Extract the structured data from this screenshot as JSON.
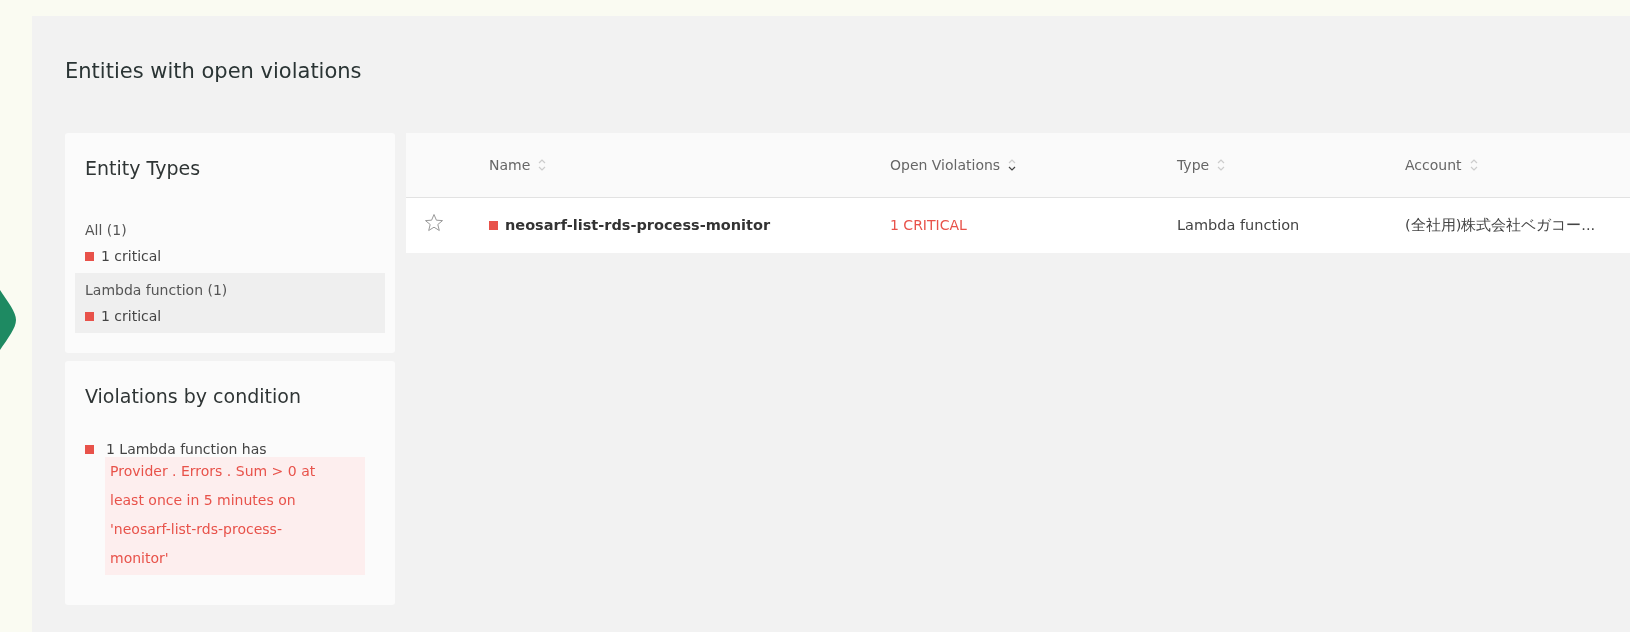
{
  "title": "Entities with open violations",
  "entity_types": {
    "heading": "Entity Types",
    "items": [
      {
        "label": "All (1)",
        "count": "1 critical",
        "color": "#e8524a",
        "selected": false
      },
      {
        "label": "Lambda function (1)",
        "count": "1 critical",
        "color": "#e8524a",
        "selected": true
      }
    ]
  },
  "conditions": {
    "heading": "Violations by condition",
    "items": [
      {
        "lead": "1 Lambda function has",
        "detail": "Provider . Errors . Sum > 0 at least once in 5 minutes on 'neosarf-list-rds-process-monitor'",
        "color": "#e8524a"
      }
    ]
  },
  "table": {
    "columns": [
      {
        "label": "Name",
        "sorted": false
      },
      {
        "label": "Open Violations",
        "sorted": true
      },
      {
        "label": "Type",
        "sorted": false
      },
      {
        "label": "Account",
        "sorted": false
      }
    ],
    "rows": [
      {
        "starred": false,
        "color": "#e8524a",
        "name": "neosarf-list-rds-process-monitor",
        "violations": "1 CRITICAL",
        "type": "Lambda function",
        "account": "(全社用)株式会社ベガコー..."
      }
    ]
  }
}
